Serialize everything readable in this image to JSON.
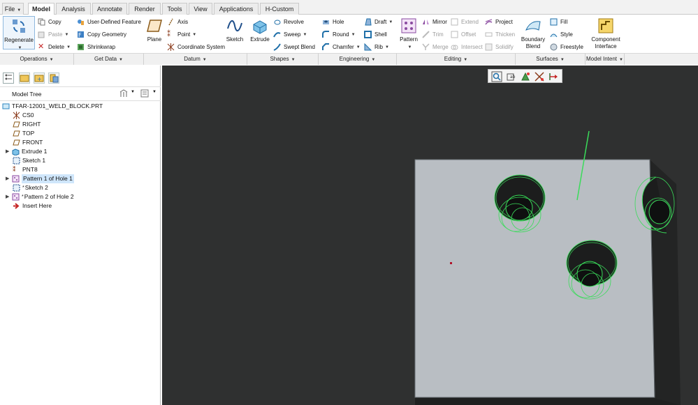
{
  "tabs": [
    "File",
    "Model",
    "Analysis",
    "Annotate",
    "Render",
    "Tools",
    "View",
    "Applications",
    "H-Custom"
  ],
  "active_tab": "Model",
  "ribbon": {
    "operations": {
      "regenerate": "Regenerate",
      "copy": "Copy",
      "paste": "Paste",
      "delete": "Delete",
      "group": "Operations"
    },
    "get_data": {
      "udf": "User-Defined Feature",
      "copy_geometry": "Copy Geometry",
      "shrinkwrap": "Shrinkwrap",
      "group": "Get Data"
    },
    "datum": {
      "plane": "Plane",
      "axis": "Axis",
      "point": "Point",
      "coord": "Coordinate System",
      "sketch": "Sketch",
      "group": "Datum"
    },
    "shapes": {
      "extrude": "Extrude",
      "revolve": "Revolve",
      "sweep": "Sweep",
      "swept_blend": "Swept Blend",
      "group": "Shapes"
    },
    "engineering": {
      "hole": "Hole",
      "round": "Round",
      "chamfer": "Chamfer",
      "draft": "Draft",
      "shell": "Shell",
      "rib": "Rib",
      "group": "Engineering"
    },
    "editing": {
      "pattern": "Pattern",
      "mirror": "Mirror",
      "trim": "Trim",
      "merge": "Merge",
      "extend": "Extend",
      "offset": "Offset",
      "intersect": "Intersect",
      "project": "Project",
      "thicken": "Thicken",
      "solidify": "Solidify",
      "group": "Editing"
    },
    "surfaces": {
      "boundary_blend": "Boundary Blend",
      "fill": "Fill",
      "style": "Style",
      "freestyle": "Freestyle",
      "group": "Surfaces"
    },
    "model_intent": {
      "component_interface": "Component Interface",
      "group": "Model Intent"
    }
  },
  "model_tree": {
    "title": "Model Tree",
    "root": "TFAR-12001_WELD_BLOCK.PRT",
    "items": [
      "CS0",
      "RIGHT",
      "TOP",
      "FRONT",
      "Extrude 1",
      "Sketch 1",
      "PNT8",
      "Pattern 1 of Hole 1",
      "Sketch 2",
      "Pattern 2 of Hole 2",
      "Insert Here"
    ]
  },
  "colors": {
    "viewport_bg": "#2f3030",
    "part_face": "#b9bec3",
    "edge_highlight": "#3adc5a",
    "selection": "#cfe6fb"
  }
}
